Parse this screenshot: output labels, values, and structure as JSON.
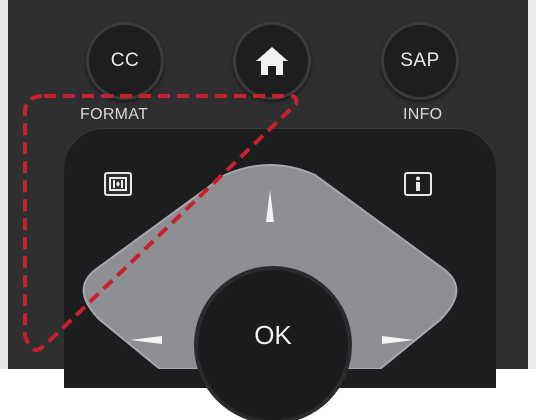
{
  "buttons": {
    "cc_label": "CC",
    "sap_label": "SAP",
    "ok_label": "OK"
  },
  "labels": {
    "format": "FORMAT",
    "info": "INFO"
  },
  "icons": {
    "home": "home-icon",
    "format": "aspect-format-icon",
    "info": "info-icon",
    "up": "arrow-up-icon",
    "left": "arrow-left-icon",
    "right": "arrow-right-icon"
  },
  "colors": {
    "remote": "#2e2f31",
    "button": "#1d1e20",
    "dpad": "#8c8d90",
    "highlight_dash": "#c8202c"
  }
}
